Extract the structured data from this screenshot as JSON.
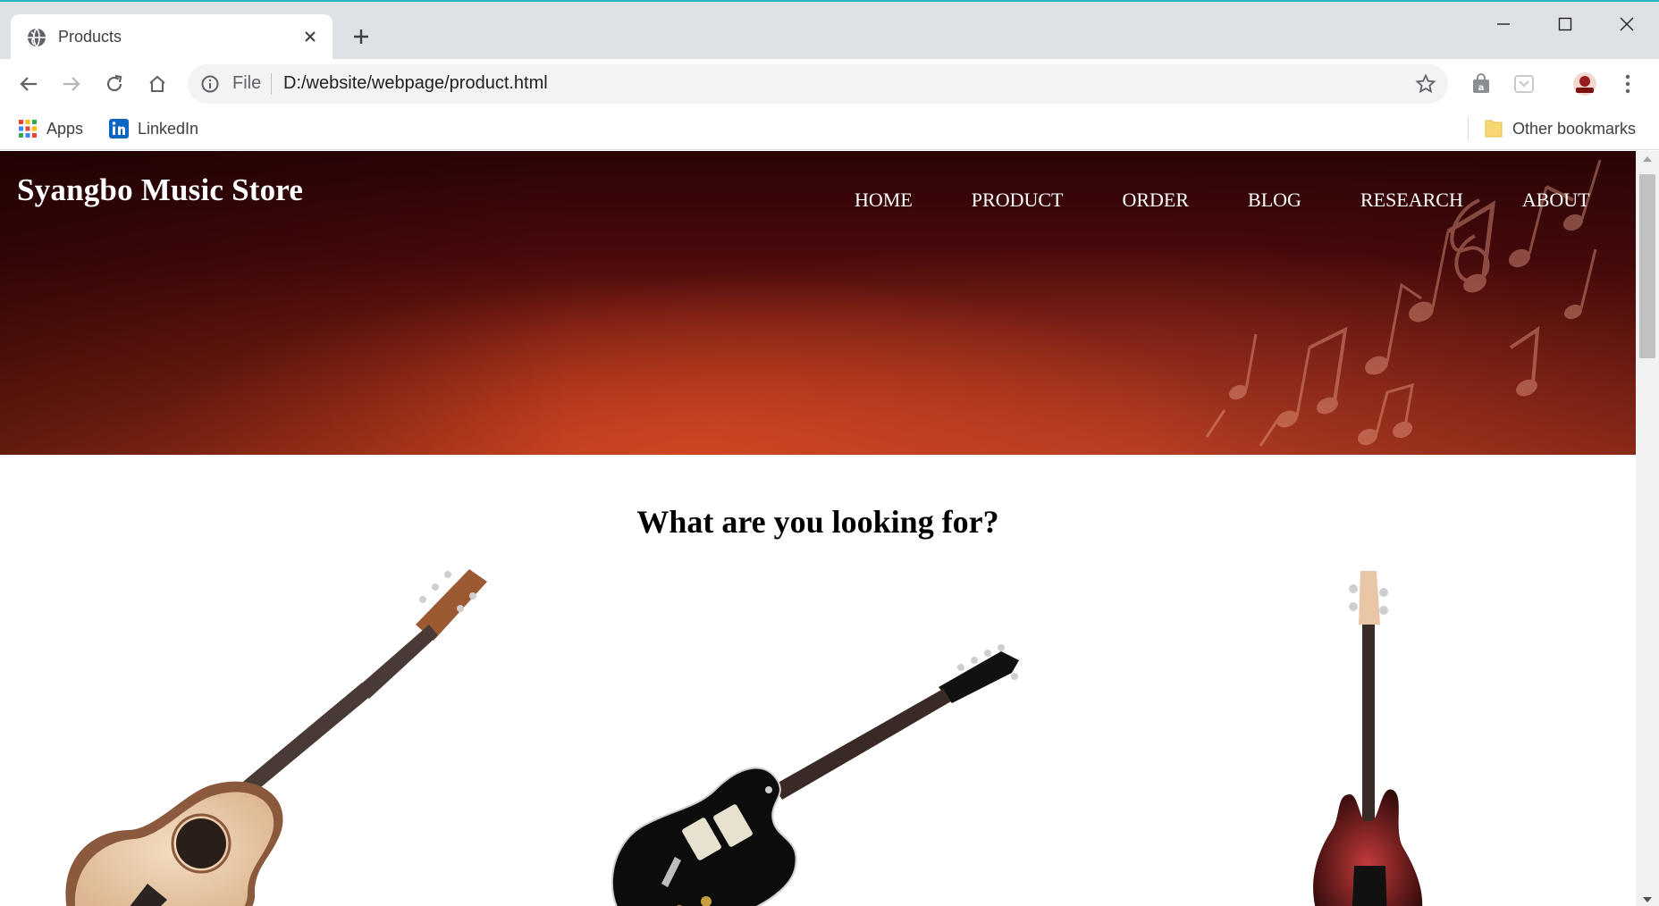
{
  "browser": {
    "tab": {
      "title": "Products",
      "favicon": "globe-icon"
    },
    "omnibox": {
      "scheme_label": "File",
      "url": "D:/website/webpage/product.html"
    },
    "bookmarks": [
      {
        "label": "Apps",
        "icon": "apps-grid-icon"
      },
      {
        "label": "LinkedIn",
        "icon": "linkedin-icon"
      }
    ],
    "other_bookmarks": "Other bookmarks"
  },
  "site": {
    "brand": "Syangbo Music Store",
    "nav": [
      "HOME",
      "PRODUCT",
      "ORDER",
      "BLOG",
      "RESEARCH",
      "ABOUT"
    ],
    "heading": "What are you looking for?"
  },
  "products": [
    {
      "kind": "acoustic-guitar"
    },
    {
      "kind": "electric-guitar"
    },
    {
      "kind": "bass-guitar"
    }
  ],
  "colors": {
    "tab_strip": "#dee1e6",
    "omnibox": "#f1f3f4",
    "hero_dark": "#2b0406",
    "hero_glow": "#d64822",
    "text_white": "#ffffff"
  }
}
